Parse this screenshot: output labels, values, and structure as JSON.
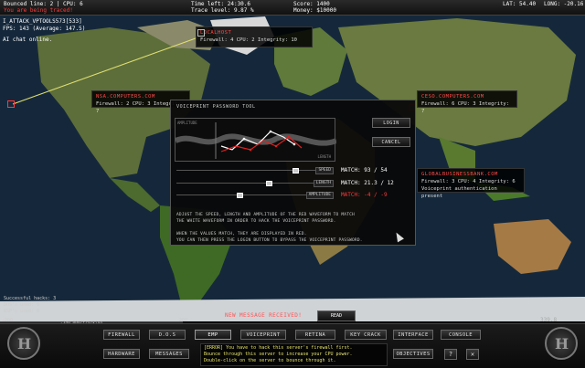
{
  "topbar": {
    "bounced_line": "Bounced line: 2 | CPU: 6",
    "warning": "You are being traced!",
    "time_left": "Time left: 24:30.6",
    "trace_level": "Trace level: 9.87 %",
    "score": "Score: 1400",
    "money": "Money: $10000",
    "lat": "LAT: 54.40",
    "lon": "LONG: -20.16"
  },
  "overlay": {
    "attack_line": "I_ATTACK_VPTOOLS573[533]",
    "fps_line": "FPS: 143 (Average: 147.5)",
    "chat_line": "AI chat online."
  },
  "servers": {
    "localhost": {
      "title": "LOCALHOST",
      "info_prefix": "Firewall: 4 CPU: 2 Integrity: 10"
    },
    "nsa": {
      "title": "NSA.COMPUTERS.COM",
      "info": "Firewall: 2 CPU: 3 Integrity: 7"
    },
    "ceso": {
      "title": "CESO.COMPUTERS.COM",
      "info": "Firewall: 6 CPU: 3 Integrity: 7"
    },
    "global": {
      "title": "GLOBALBUSINESSBANK.COM",
      "info": "Firewall: 3 CPU: 4 Integrity: 6",
      "note": "Voiceprint authentication present"
    }
  },
  "dialog": {
    "title": "VOICEPRINT PASSWORD TOOL",
    "wave_label_top": "AMPLITUDE",
    "wave_label_bottom": "LENGTH",
    "login_label": "LOGIN",
    "cancel_label": "CANCEL",
    "speed_label": "SPEED",
    "length_label": "LENGTH",
    "amplitude_label": "AMPLITUDE",
    "match_speed": "MATCH: 93 / 54",
    "match_length": "MATCH: 21.3 / 12",
    "match_amplitude": "MATCH: -4 / -9",
    "instructions": [
      "ADJUST THE SPEED, LENGTH AND AMPLITUDE OF THE RED WAVEFORM TO MATCH",
      "THE WHITE WAVEFORM IN ORDER TO HACK THE VOICEPRINT PASSWORD.",
      "",
      "WHEN THE VALUES MATCH, THEY ARE DISPLAYED IN RED.",
      "YOU CAN THEN PRESS THE LOGIN BUTTON TO BYPASS THE VOICEPRINT PASSWORD."
    ]
  },
  "stats": {
    "lines": [
      "Successful hacks: 3",
      "DOS's used:      0",
      "ESP's used:      0"
    ]
  },
  "tracking": {
    "left_tick": "-200",
    "right_tick": "200",
    "text": "-340,000/tracking"
  },
  "messages": {
    "new_message": "NEW MESSAGE RECEIVED!",
    "read_label": "READ",
    "lines": [
      "[ERROR] You have to hack this server's firewall first.",
      "Bounce through this server to increase your CPU power.",
      "Double-click on the server to bounce through it."
    ]
  },
  "top_number": "339.8",
  "console": {
    "row1": [
      "FIREWALL",
      "D.O.S",
      "EMP",
      "VOICEPRINT",
      "RETINA",
      "KEY CRACK",
      "INTERFACE",
      "CONSOLE"
    ],
    "hardware_label": "HARDWARE",
    "messages_label": "MESSAGES",
    "objectives_label": "OBJECTIVES",
    "trophy_icon": "?",
    "close_icon": "✕"
  },
  "colors": {
    "accent_red": "#ff3b3b",
    "accent_yellow": "#e7e56a",
    "ocean": "#1a2a3a",
    "land": "#556b2f"
  }
}
